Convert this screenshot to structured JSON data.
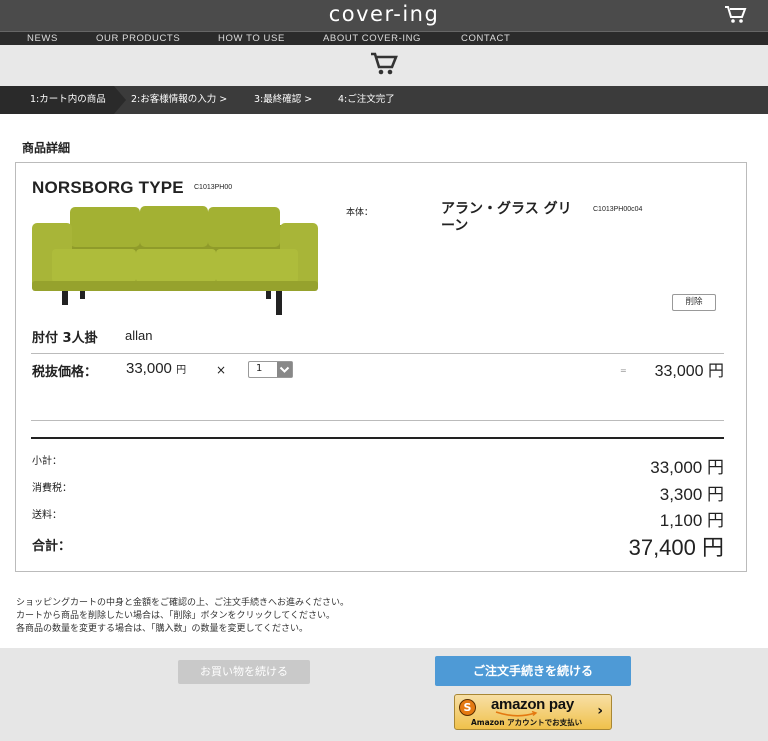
{
  "header": {
    "logo": "cover-ing",
    "cart_icon": "cart-icon",
    "nav": [
      "NEWS",
      "OUR PRODUCTS",
      "HOW TO USE",
      "ABOUT COVER-ING",
      "CONTACT"
    ]
  },
  "steps": [
    "1:カート内の商品",
    "2:お客様情報の入力 >",
    "3:最終確認 >",
    "4:ご注文完了"
  ],
  "section_title": "商品詳細",
  "item": {
    "name": "NORSBORG TYPE",
    "code": "C1013PH00",
    "body_label": "本体：",
    "color_name": "アラン・グラス グリーン",
    "color_code": "C1013PH00c04",
    "delete_label": "削除",
    "variant": "肘付 3人掛",
    "fabric": "allan",
    "price_label": "税抜価格：",
    "unit_price": "33,000",
    "yen": "円",
    "times": "×",
    "quantity": "1",
    "equals": "=",
    "line_total": "33,000 円",
    "image_color": "#a3b133"
  },
  "summary": {
    "subtotal_label": "小計：",
    "subtotal": "33,000 円",
    "tax_label": "消費税：",
    "tax": "3,300 円",
    "shipping_label": "送料：",
    "shipping": "1,100 円",
    "total_label": "合計：",
    "total": "37,400 円"
  },
  "notes": [
    "ショッピングカートの中身と金額をご確認の上、ご注文手続きへお進みください。",
    "カートから商品を削除したい場合は、「削除」ボタンをクリックしてください。",
    "各商品の数量を変更する場合は、「購入数」の数量を変更してください。"
  ],
  "footer": {
    "continue_label": "お買い物を続ける",
    "checkout_label": "ご注文手続きを続ける",
    "amazon_brand": "amazon pay",
    "amazon_sub": "Amazon アカウントでお支払い",
    "amazon_chevron": "›",
    "amazon_s": "S"
  },
  "colors": {
    "accent": "#4e9ad6",
    "header_bg": "#4b4b4b",
    "step_bg": "#3b3b3b"
  }
}
